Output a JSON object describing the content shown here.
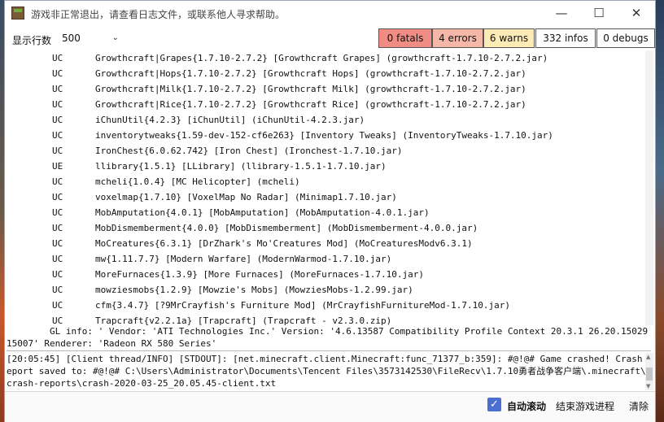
{
  "window": {
    "title": "游戏非正常退出，请查看日志文件，或联系他人寻求帮助。",
    "min_glyph": "—",
    "max_glyph": "☐",
    "close_glyph": "✕"
  },
  "toolbar": {
    "rows_label": "显示行数",
    "rows_value": "500",
    "fatals": "0 fatals",
    "errors": "4 errors",
    "warns": "6 warns",
    "infos": "332 infos",
    "debugs": "0 debugs"
  },
  "log_rows": [
    {
      "state": "UC",
      "mod": "Growthcraft|Grapes{1.7.10-2.7.2} [Growthcraft Grapes] (growthcraft-1.7.10-2.7.2.jar)"
    },
    {
      "state": "UC",
      "mod": "Growthcraft|Hops{1.7.10-2.7.2} [Growthcraft Hops] (growthcraft-1.7.10-2.7.2.jar)"
    },
    {
      "state": "UC",
      "mod": "Growthcraft|Milk{1.7.10-2.7.2} [Growthcraft Milk] (growthcraft-1.7.10-2.7.2.jar)"
    },
    {
      "state": "UC",
      "mod": "Growthcraft|Rice{1.7.10-2.7.2} [Growthcraft Rice] (growthcraft-1.7.10-2.7.2.jar)"
    },
    {
      "state": "UC",
      "mod": "iChunUtil{4.2.3} [iChunUtil] (iChunUtil-4.2.3.jar)"
    },
    {
      "state": "UC",
      "mod": "inventorytweaks{1.59-dev-152-cf6e263} [Inventory Tweaks] (InventoryTweaks-1.7.10.jar)"
    },
    {
      "state": "UC",
      "mod": "IronChest{6.0.62.742} [Iron Chest] (Ironchest-1.7.10.jar)"
    },
    {
      "state": "UE",
      "mod": "llibrary{1.5.1} [LLibrary] (llibrary-1.5.1-1.7.10.jar)"
    },
    {
      "state": "UC",
      "mod": "mcheli{1.0.4} [MC Helicopter] (mcheli)"
    },
    {
      "state": "UC",
      "mod": "voxelmap{1.7.10} [VoxelMap No Radar] (Minimap1.7.10.jar)"
    },
    {
      "state": "UC",
      "mod": "MobAmputation{4.0.1} [MobAmputation] (MobAmputation-4.0.1.jar)"
    },
    {
      "state": "UC",
      "mod": "MobDismemberment{4.0.0} [MobDismemberment] (MobDismemberment-4.0.0.jar)"
    },
    {
      "state": "UC",
      "mod": "MoCreatures{6.3.1} [DrZhark's Mo'Creatures Mod] (MoCreaturesModv6.3.1)"
    },
    {
      "state": "UC",
      "mod": "mw{1.11.7.7} [Modern Warfare] (ModernWarmod-1.7.10.jar)"
    },
    {
      "state": "UC",
      "mod": "MoreFurnaces{1.3.9} [More Furnaces] (MoreFurnaces-1.7.10.jar)"
    },
    {
      "state": "UC",
      "mod": "mowziesmobs{1.2.9} [Mowzie's Mobs] (MowziesMobs-1.2.99.jar)"
    },
    {
      "state": "UC",
      "mod": "cfm{3.4.7} [?9MrCrayfish's Furniture Mod] (MrCrayfishFurnitureMod-1.7.10.jar)"
    },
    {
      "state": "UC",
      "mod": "Trapcraft{v2.2.1a} [Trapcraft] (Trapcraft - v2.3.0.zip)"
    }
  ],
  "gl_info": "        GL info: ' Vendor: 'ATI Technologies Inc.' Version: '4.6.13587 Compatibility Profile Context 20.3.1 26.20.15029.\n15007' Renderer: 'Radeon RX 580 Series'",
  "stdout": "[20:05:45] [Client thread/INFO] [STDOUT]: [net.minecraft.client.Minecraft:func_71377_b:359]: #@!@# Game crashed! Crash r\neport saved to: #@!@# C:\\Users\\Administrator\\Documents\\Tencent Files\\3573142530\\FileRecv\\1.7.10勇者战争客户端\\.minecraft\\\ncrash-reports\\crash-2020-03-25_20.05.45-client.txt",
  "bottom": {
    "auto_scroll_label": "自动滚动",
    "check_glyph": "✓",
    "end_process_label": "结束游戏进程",
    "clear_label": "清除"
  },
  "colors": {
    "fatal_bg": "#f08c84",
    "error_bg": "#f5b8a8",
    "warn_bg": "#fcebb5",
    "checkbox_accent": "#4a6fd1"
  }
}
